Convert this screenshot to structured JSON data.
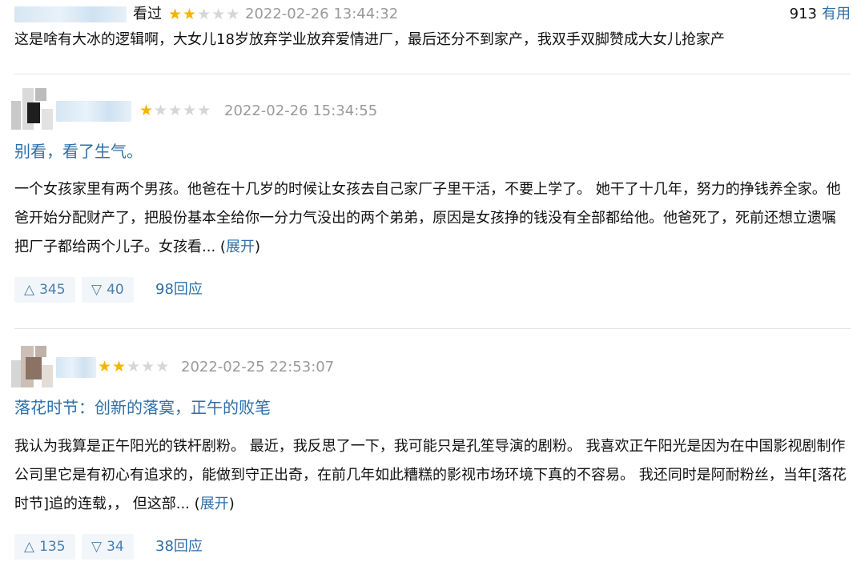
{
  "review0": {
    "watched": "看过",
    "stars_on": 2,
    "time": "2022-02-26 13:44:32",
    "useful_count": "913",
    "useful_label": "有用",
    "text": "这是啥有大冰的逻辑啊，大女儿18岁放弃学业放弃爱情进厂，最后还分不到家产，我双手双脚赞成大女儿抢家产"
  },
  "review1": {
    "stars_on": 1,
    "time": "2022-02-26 15:34:55",
    "title": "别看，看了生气。",
    "text": "一个女孩家里有两个男孩。他爸在十几岁的时候让女孩去自己家厂子里干活，不要上学了。 她干了十几年，努力的挣钱养全家。他爸开始分配财产了，把股份基本全给你一分力气没出的两个弟弟，原因是女孩挣的钱没有全部都给他。他爸死了，死前还想立遗嘱把厂子都给两个儿子。女孩看...",
    "expand_open": "(",
    "expand": "展开",
    "expand_close": ")",
    "up": "345",
    "down": "40",
    "replies": "98回应"
  },
  "review2": {
    "stars_on": 2,
    "time": "2022-02-25 22:53:07",
    "title": "落花时节：创新的落寞，正午的败笔",
    "text": "我认为我算是正午阳光的铁杆剧粉。 最近，我反思了一下，我可能只是孔笙导演的剧粉。 我喜欢正午阳光是因为在中国影视剧制作公司里它是有初心有追求的，能做到守正出奇，在前几年如此糟糕的影视市场环境下真的不容易。 我还同时是阿耐粉丝，当年[落花时节]追的连载，， 但这部...",
    "expand_open": "(",
    "expand": "展开",
    "expand_close": ")",
    "up": "135",
    "down": "34",
    "replies": "38回应"
  },
  "icons": {
    "star": "★",
    "up": "△",
    "down": "▽"
  },
  "colors": {
    "link": "#2f6fa8",
    "star": "#f4b400",
    "vote_bg": "#f2f6fa"
  }
}
